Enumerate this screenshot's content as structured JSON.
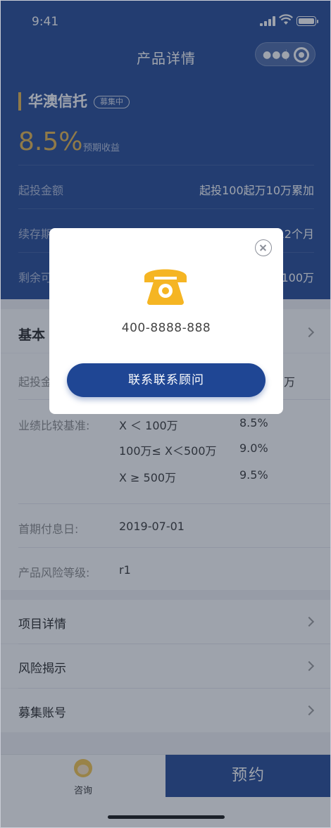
{
  "status_bar": {
    "time": "9:41"
  },
  "nav": {
    "title": "产品详情",
    "more_icon": "ellipsis-icon",
    "close_icon": "target-icon"
  },
  "product": {
    "name": "华澳信托",
    "badge": "募集中",
    "rate": "8.5%",
    "rate_label": "预期收益",
    "rows": [
      {
        "label": "起投金额",
        "value": "起投100起万10万累加"
      },
      {
        "label": "续存期",
        "value": "12个月"
      },
      {
        "label": "剩余可",
        "value": "100万"
      }
    ]
  },
  "basic_section": {
    "title": "基本",
    "details": {
      "min_label": "起投金",
      "min_value": "万",
      "benchmark_label": "业绩比较基准:",
      "tiers": [
        {
          "range": "X ＜ 100万",
          "rate": "8.5%"
        },
        {
          "range": "100万≤ X＜500万",
          "rate": "9.0%"
        },
        {
          "range": "X ≥ 500万",
          "rate": "9.5%"
        }
      ],
      "first_interest_label": "首期付息日:",
      "first_interest_value": "2019-07-01",
      "risk_label": "产品风险等级:",
      "risk_value": "r1"
    }
  },
  "menu": [
    {
      "label": "项目详情"
    },
    {
      "label": "风险揭示"
    },
    {
      "label": "募集账号"
    }
  ],
  "bottom_bar": {
    "consult_label": "咨询",
    "reserve_label": "预约"
  },
  "modal": {
    "phone": "400-8888-888",
    "button_label": "联系联系顾问"
  },
  "colors": {
    "primary": "#1f4694",
    "accent": "#e6b54a",
    "phone_icon": "#f5b523"
  }
}
